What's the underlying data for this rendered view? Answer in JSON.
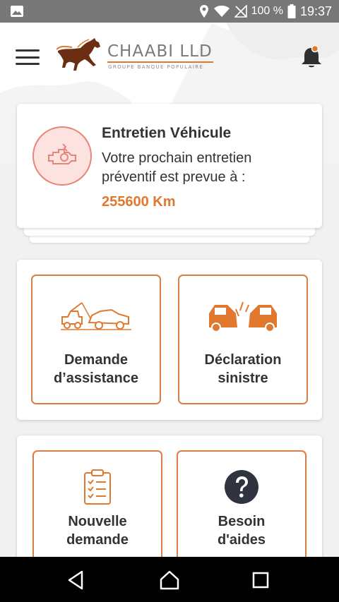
{
  "status_bar": {
    "battery_percent": "100 %",
    "time": "19:37"
  },
  "header": {
    "brand_name": "CHAABI LLD",
    "brand_tagline": "GROUPE BANQUE POPULAIRE"
  },
  "maintenance_card": {
    "title": "Entretien Véhicule",
    "message_line1": "Votre prochain entretien",
    "message_line2": "préventif est prevue à :",
    "mileage": "255600 Km"
  },
  "tiles": [
    {
      "line1": "Demande",
      "line2": "d’assistance",
      "icon": "tow-truck-icon"
    },
    {
      "line1": "Déclaration",
      "line2": "sinistre",
      "icon": "car-crash-icon"
    },
    {
      "line1": "Nouvelle",
      "line2": "demande",
      "icon": "clipboard-checklist-icon"
    },
    {
      "line1": "Besoin",
      "line2": "d'aides",
      "icon": "help-icon"
    }
  ],
  "colors": {
    "accent": "#e0782f",
    "tile_border": "#d87f45",
    "icon_bg": "#fde3df",
    "status_bar": "#777777"
  }
}
